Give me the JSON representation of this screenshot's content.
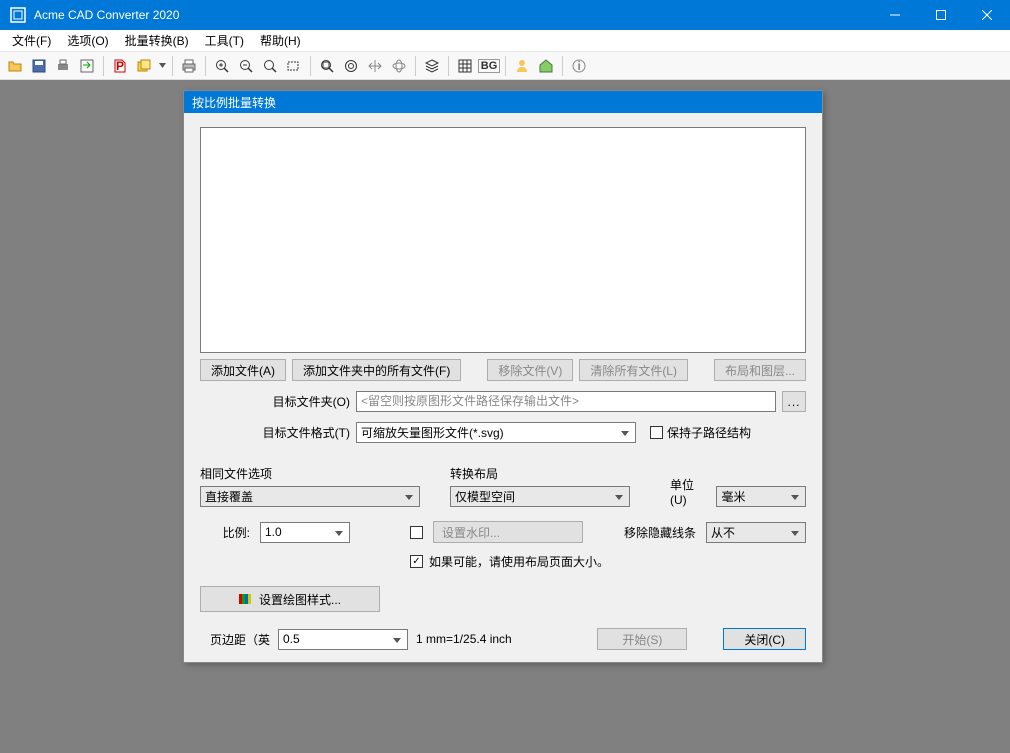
{
  "app": {
    "title": "Acme CAD Converter 2020"
  },
  "menu": {
    "file": "文件(F)",
    "options": "选项(O)",
    "batch": "批量转换(B)",
    "tools": "工具(T)",
    "help": "帮助(H)"
  },
  "toolbar": {
    "bg_label": "BG"
  },
  "dialog": {
    "title": "按比例批量转换",
    "buttons": {
      "add_file": "添加文件(A)",
      "add_folder": "添加文件夹中的所有文件(F)",
      "remove_file": "移除文件(V)",
      "clear_all": "清除所有文件(L)",
      "layout_layers": "布局和图层..."
    },
    "target_folder_label": "目标文件夹(O)",
    "target_folder_placeholder": "<留空则按原图形文件路径保存输出文件>",
    "browse": "...",
    "target_format_label": "目标文件格式(T)",
    "target_format_value": "可缩放矢量图形文件(*.svg)",
    "keep_sub_path": "保持子路径结构",
    "same_file_label": "相同文件选项",
    "same_file_value": "直接覆盖",
    "convert_layout_label": "转换布局",
    "convert_layout_value": "仅模型空间",
    "unit_label": "单位(U)",
    "unit_value": "毫米",
    "scale_label": "比例:",
    "scale_value": "1.0",
    "watermark_label": "设置水印...",
    "remove_hidden_label": "移除隐藏线条",
    "remove_hidden_value": "从不",
    "use_layout_page_size": "如果可能，请使用布局页面大小。",
    "plot_style_btn": "设置绘图样式...",
    "margin_label": "页边距（英",
    "margin_value": "0.5",
    "mm_inch_hint": "1 mm=1/25.4 inch",
    "start_btn": "开始(S)",
    "close_btn": "关闭(C)"
  }
}
